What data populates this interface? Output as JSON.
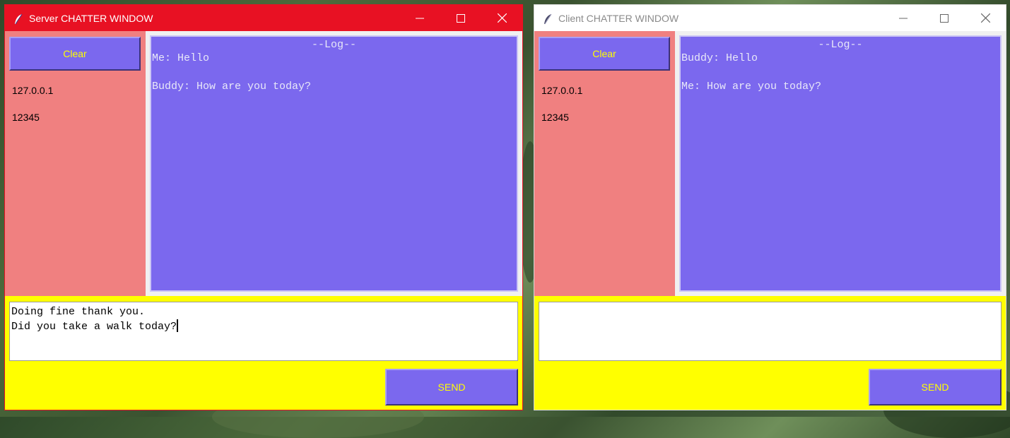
{
  "colors": {
    "server_titlebar": "#e81123",
    "client_titlebar": "#ffffff",
    "sidebar": "#f08080",
    "log_background": "#7b68ee",
    "button_background": "#7b68ee",
    "button_text": "#ffff00",
    "input_area": "#ffff00"
  },
  "server": {
    "title": "Server CHATTER WINDOW",
    "icon": "feather-icon",
    "clear_label": "Clear",
    "ip": "127.0.0.1",
    "port": "12345",
    "log": {
      "header": "--Log--",
      "lines": [
        "Me: Hello",
        "",
        "Buddy: How are you today?"
      ]
    },
    "input_lines": [
      "Doing fine thank you.",
      "Did you take a walk today?"
    ],
    "send_label": "SEND"
  },
  "client": {
    "title": "Client CHATTER WINDOW",
    "icon": "feather-icon",
    "clear_label": "Clear",
    "ip": "127.0.0.1",
    "port": "12345",
    "log": {
      "header": "--Log--",
      "lines": [
        "Buddy: Hello",
        "",
        "Me: How are you today?"
      ]
    },
    "input_lines": [],
    "send_label": "SEND"
  }
}
